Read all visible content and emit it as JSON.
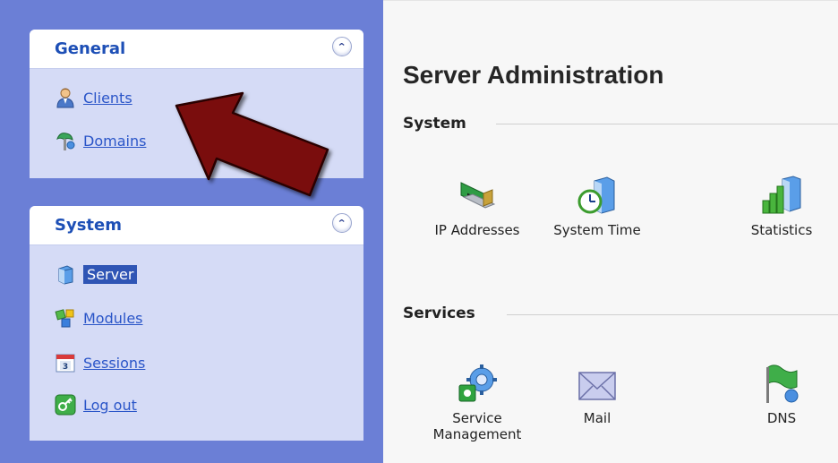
{
  "sidebar": {
    "panels": [
      {
        "title": "General",
        "items": [
          {
            "label": "Clients",
            "icon": "user-icon"
          },
          {
            "label": "Domains",
            "icon": "domains-icon"
          }
        ]
      },
      {
        "title": "System",
        "items": [
          {
            "label": "Server",
            "icon": "server-icon",
            "active": true
          },
          {
            "label": "Modules",
            "icon": "modules-icon"
          },
          {
            "label": "Sessions",
            "icon": "sessions-icon"
          },
          {
            "label": "Log out",
            "icon": "logout-icon"
          }
        ]
      }
    ]
  },
  "main": {
    "title": "Server Administration",
    "sections": [
      {
        "title": "System",
        "tools": [
          {
            "label": "IP Addresses",
            "icon": "network-card-icon"
          },
          {
            "label": "System Time",
            "icon": "clock-icon"
          },
          {
            "label": "Statistics",
            "icon": "statistics-icon"
          }
        ]
      },
      {
        "title": "Services",
        "tools": [
          {
            "label_line1": "Service",
            "label_line2": "Management",
            "icon": "service-gear-icon"
          },
          {
            "label": "Mail",
            "icon": "mail-icon"
          },
          {
            "label": "DNS",
            "icon": "dns-flag-icon"
          }
        ]
      }
    ]
  },
  "colors": {
    "sidebar_bg": "#6b7fd6",
    "panel_bg": "#d5dbf6",
    "panel_title": "#1d4fb6",
    "link": "#2a55c8",
    "active_bg": "#2f55b5",
    "arrow": "#7a0f0f"
  }
}
